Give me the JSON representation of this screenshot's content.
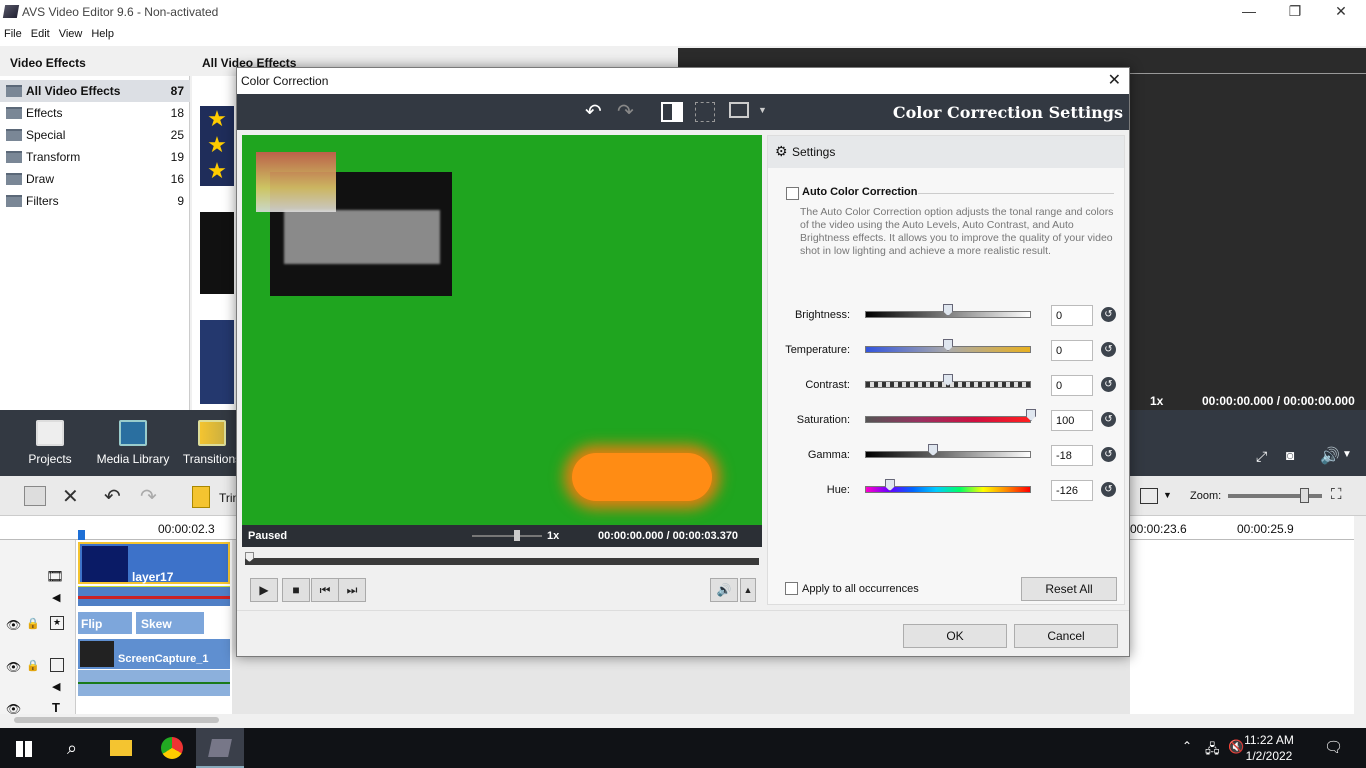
{
  "app": {
    "title": "AVS Video Editor 9.6 - Non-activated",
    "menu": [
      "File",
      "Edit",
      "View",
      "Help"
    ]
  },
  "effects_panel": {
    "header": "Video Effects",
    "items": [
      {
        "label": "All Video Effects",
        "count": "87"
      },
      {
        "label": "Effects",
        "count": "18"
      },
      {
        "label": "Special",
        "count": "25"
      },
      {
        "label": "Transform",
        "count": "19"
      },
      {
        "label": "Draw",
        "count": "16"
      },
      {
        "label": "Filters",
        "count": "9"
      }
    ]
  },
  "effects_view": {
    "header": "All Video Effects"
  },
  "preview": {
    "speed": "1x",
    "time": "00:00:00.000 / 00:00:00.000"
  },
  "tools": [
    {
      "label": "Projects"
    },
    {
      "label": "Media Library"
    },
    {
      "label": "Transitions"
    }
  ],
  "timeline": {
    "trim_label": "Trim",
    "zoom_label": "Zoom:",
    "ruler": [
      "00:00:02.3",
      "00:00:23.6",
      "00:00:25.9"
    ],
    "clip_layer": "layer17",
    "effect_clips": [
      "Flip",
      "Skew"
    ],
    "clip_capture": "ScreenCapture_1"
  },
  "taskbar": {
    "time": "11:22 AM",
    "date": "1/2/2022"
  },
  "dialog": {
    "title": "Color Correction",
    "settings_title": "Color Correction Settings",
    "video_status": "Paused",
    "video_speed": "1x",
    "video_time": "00:00:00.000 / 00:00:03.370",
    "settings_header": "Settings",
    "auto_label": "Auto Color Correction",
    "auto_description": "The Auto Color Correction option adjusts the tonal range and colors of the video using the Auto Levels, Auto Contrast, and Auto Brightness effects. It allows you to improve the quality of your video shot in low lighting and achieve a more realistic result.",
    "sliders": [
      {
        "label": "Brightness:",
        "value": "0",
        "position": 0.5
      },
      {
        "label": "Temperature:",
        "value": "0",
        "position": 0.5
      },
      {
        "label": "Contrast:",
        "value": "0",
        "position": 0.5
      },
      {
        "label": "Saturation:",
        "value": "100",
        "position": 1.0
      },
      {
        "label": "Gamma:",
        "value": "-18",
        "position": 0.41
      },
      {
        "label": "Hue:",
        "value": "-126",
        "position": 0.15
      }
    ],
    "apply_all_label": "Apply to all occurrences",
    "reset_all": "Reset All",
    "ok": "OK",
    "cancel": "Cancel"
  },
  "colors": {
    "dark_toolbar": "#333942",
    "video_green": "#1fa51f",
    "orange_blob": "#ff8c14"
  }
}
